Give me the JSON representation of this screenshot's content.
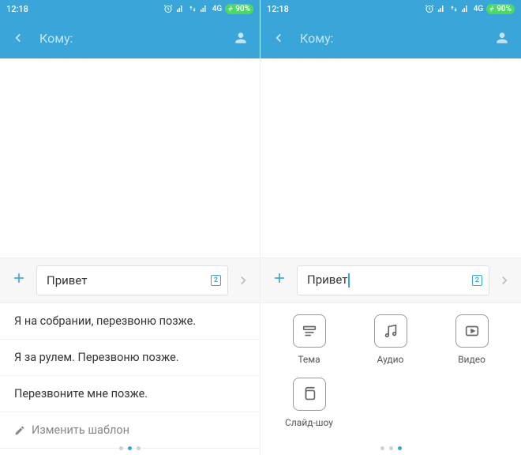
{
  "statusbar": {
    "time": "12:18",
    "network": "4G",
    "battery": "90%"
  },
  "header": {
    "to_label": "Кому:"
  },
  "compose": {
    "text": "Привет",
    "sim": "2"
  },
  "templates": {
    "items": [
      "Я на собрании, перезвоню позже.",
      "Я за рулем. Перезвоню позже.",
      "Перезвоните мне позже."
    ],
    "edit_label": "Изменить шаблон"
  },
  "attach": {
    "items": [
      {
        "label": "Тема"
      },
      {
        "label": "Аудио"
      },
      {
        "label": "Видео"
      },
      {
        "label": "Слайд-шоу"
      }
    ]
  }
}
